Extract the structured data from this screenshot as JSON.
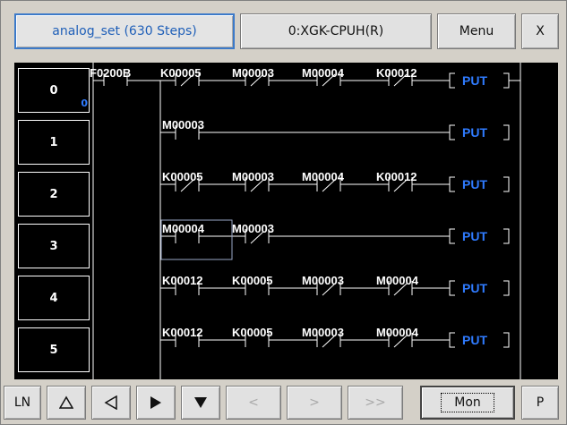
{
  "toolbar": {
    "program_label": "analog_set (630 Steps)",
    "cpu_label": "0:XGK-CPUH(R)",
    "menu_label": "Menu",
    "close_label": "X"
  },
  "ladder": {
    "row_numbers": [
      "0",
      "1",
      "2",
      "3",
      "4",
      "5"
    ],
    "row0_step": "0",
    "rows": [
      {
        "contacts": [
          "F0200B",
          "K00005",
          "M00003",
          "M00004",
          "K00012"
        ],
        "coil": "PUT"
      },
      {
        "contacts": [
          "M00003"
        ],
        "coil": "PUT"
      },
      {
        "contacts": [
          "K00005",
          "M00003",
          "M00004",
          "K00012"
        ],
        "coil": "PUT"
      },
      {
        "contacts": [
          "M00004",
          "M00003"
        ],
        "coil": "PUT"
      },
      {
        "contacts": [
          "K00012",
          "K00005",
          "M00003",
          "M00004"
        ],
        "coil": "PUT"
      },
      {
        "contacts": [
          "K00012",
          "K00005",
          "M00003",
          "M00004"
        ],
        "coil": "PUT"
      }
    ],
    "contact_color": "#ffffff",
    "coil_color": "#2f7bff",
    "cursor_color": "#9aa7c7"
  },
  "bottombar": {
    "ln_label": "LN",
    "up_icon": "triangle-up-icon",
    "left_icon": "triangle-left-icon",
    "right_icon": "triangle-right-icon",
    "down_icon": "triangle-down-icon",
    "prev_label": "<",
    "next_label": ">",
    "fast_label": ">>",
    "mon_label": "Mon",
    "p_label": "P"
  }
}
